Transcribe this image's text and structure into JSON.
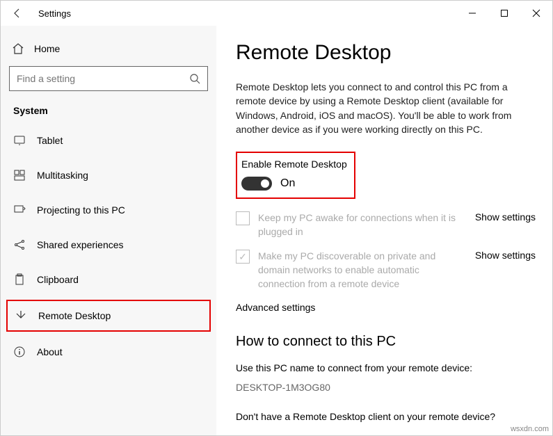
{
  "title": "Settings",
  "search": {
    "placeholder": "Find a setting"
  },
  "home": {
    "label": "Home"
  },
  "section": "System",
  "nav": {
    "tablet": "Tablet",
    "multitasking": "Multitasking",
    "projecting": "Projecting to this PC",
    "shared": "Shared experiences",
    "clipboard": "Clipboard",
    "remote": "Remote Desktop",
    "about": "About"
  },
  "main": {
    "heading": "Remote Desktop",
    "intro": "Remote Desktop lets you connect to and control this PC from a remote device by using a Remote Desktop client (available for Windows, Android, iOS and macOS). You'll be able to work from another device as if you were working directly on this PC.",
    "enable_label": "Enable Remote Desktop",
    "toggle_state": "On",
    "opt1": "Keep my PC awake for connections when it is plugged in",
    "opt2": "Make my PC discoverable on private and domain networks to enable automatic connection from a remote device",
    "show": "Show settings",
    "advanced": "Advanced settings",
    "connect_heading": "How to connect to this PC",
    "connect_sub": "Use this PC name to connect from your remote device:",
    "pc_name": "DESKTOP-1M3OG80",
    "no_client": "Don't have a Remote Desktop client on your remote device?"
  },
  "watermark": "wsxdn.com"
}
